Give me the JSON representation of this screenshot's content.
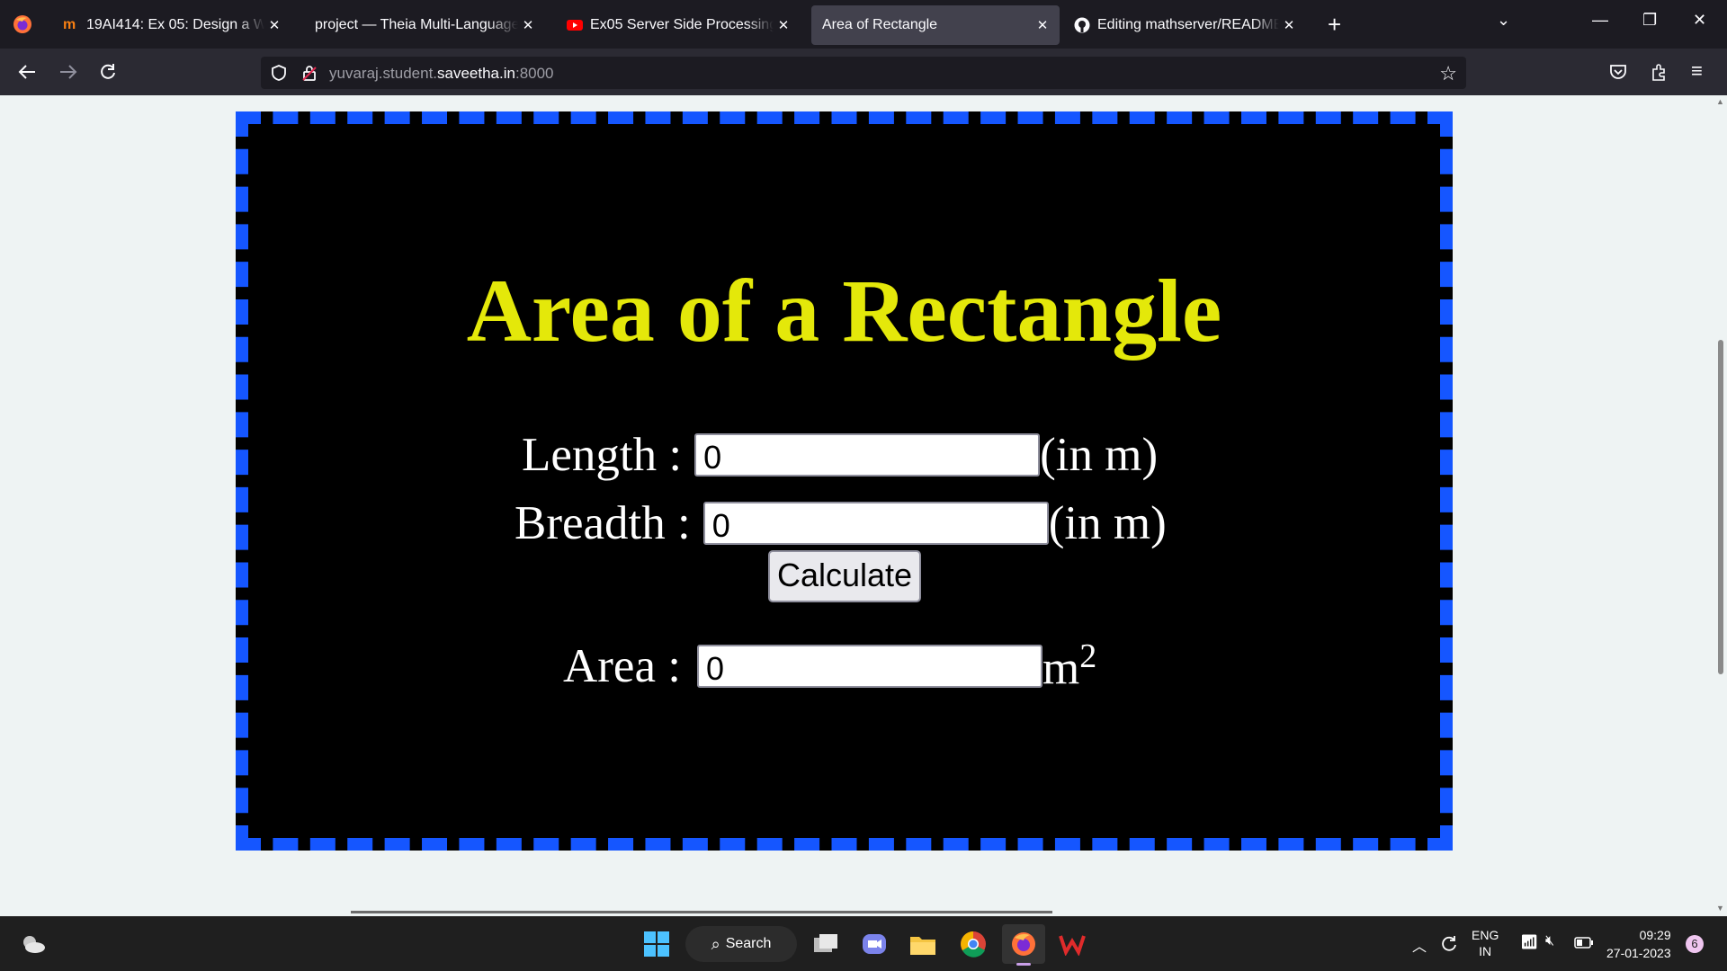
{
  "browser": {
    "tabs": [
      {
        "title": "19AI414: Ex 05: Design a Website",
        "icon": "moodle-icon",
        "active": false
      },
      {
        "title": "project — Theia Multi-Language Ex",
        "icon": "none",
        "active": false
      },
      {
        "title": "Ex05 Server Side Processing - YouTube",
        "icon": "youtube-icon",
        "active": false
      },
      {
        "title": "Area of Rectangle",
        "icon": "none",
        "active": true
      },
      {
        "title": "Editing mathserver/README.md",
        "icon": "github-icon",
        "active": false
      }
    ],
    "url_prefix": "yuvaraj.student.",
    "url_domain": "saveetha.in",
    "url_suffix": ":8000"
  },
  "page": {
    "title": "Area of a Rectangle",
    "length_label": "Length :",
    "length_value": "0",
    "length_unit": "(in m)",
    "breadth_label": "Breadth :",
    "breadth_value": "0",
    "breadth_unit": "(in m)",
    "calculate_label": "Calculate",
    "area_label": "Area :",
    "area_value": "0",
    "area_unit": "m",
    "area_unit_exp": "2",
    "colors": {
      "background": "#000000",
      "border": "#1556ff",
      "title": "#e4e80a"
    }
  },
  "taskbar": {
    "search_label": "Search",
    "language": "ENG",
    "region": "IN",
    "time": "09:29",
    "date": "27-01-2023",
    "notifications": "6"
  }
}
